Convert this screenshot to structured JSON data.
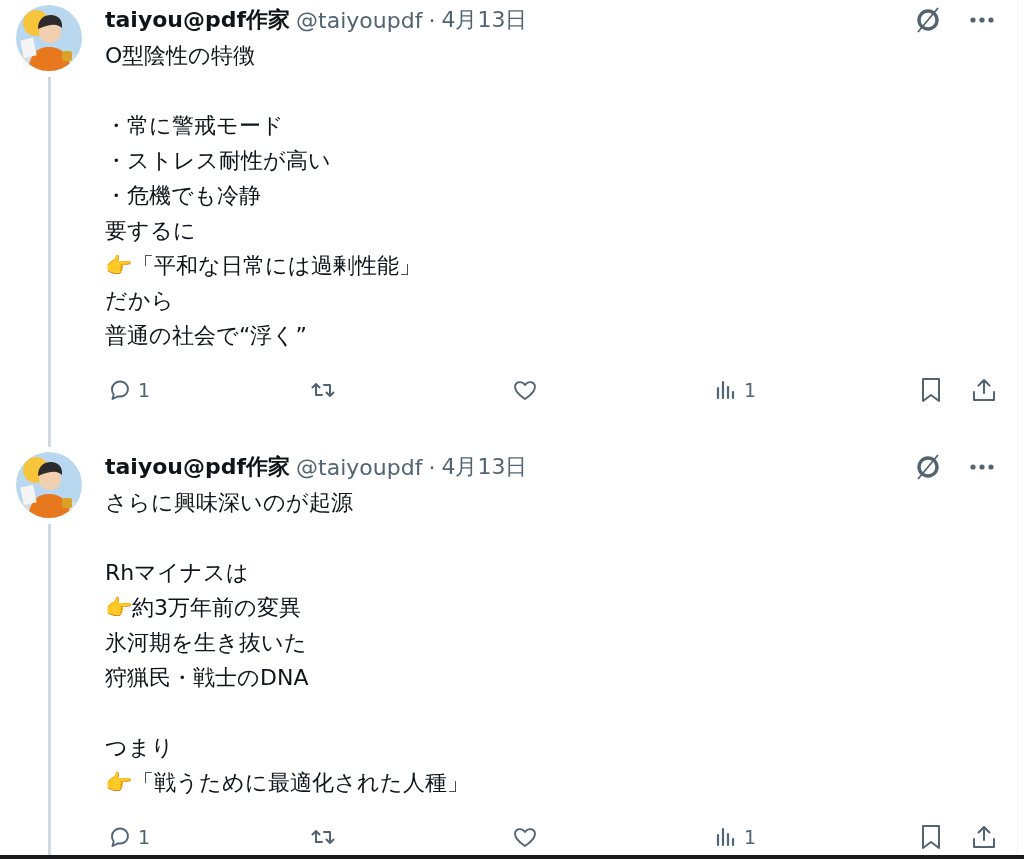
{
  "tweets": [
    {
      "author": "taiyou@pdf作家",
      "handle": "@taiyoupdf",
      "separator": "·",
      "date": "4月13日",
      "paragraphs": [
        [
          "O型陰性の特徴"
        ],
        [
          "・常に警戒モード",
          "・ストレス耐性が高い",
          "・危機でも冷静",
          "要するに",
          "👉「平和な日常には過剰性能」",
          "だから",
          "普通の社会で“浮く”"
        ]
      ],
      "replies": "1",
      "views": "1",
      "thread_line": true
    },
    {
      "author": "taiyou@pdf作家",
      "handle": "@taiyoupdf",
      "separator": "·",
      "date": "4月13日",
      "paragraphs": [
        [
          "さらに興味深いのが起源"
        ],
        [
          "Rhマイナスは",
          "👉約3万年前の変異",
          "氷河期を生き抜いた",
          "狩猟民・戦士のDNA"
        ],
        [
          "つまり",
          "👉「戦うために最適化された人種」"
        ]
      ],
      "replies": "1",
      "views": "1",
      "thread_line": true
    }
  ]
}
